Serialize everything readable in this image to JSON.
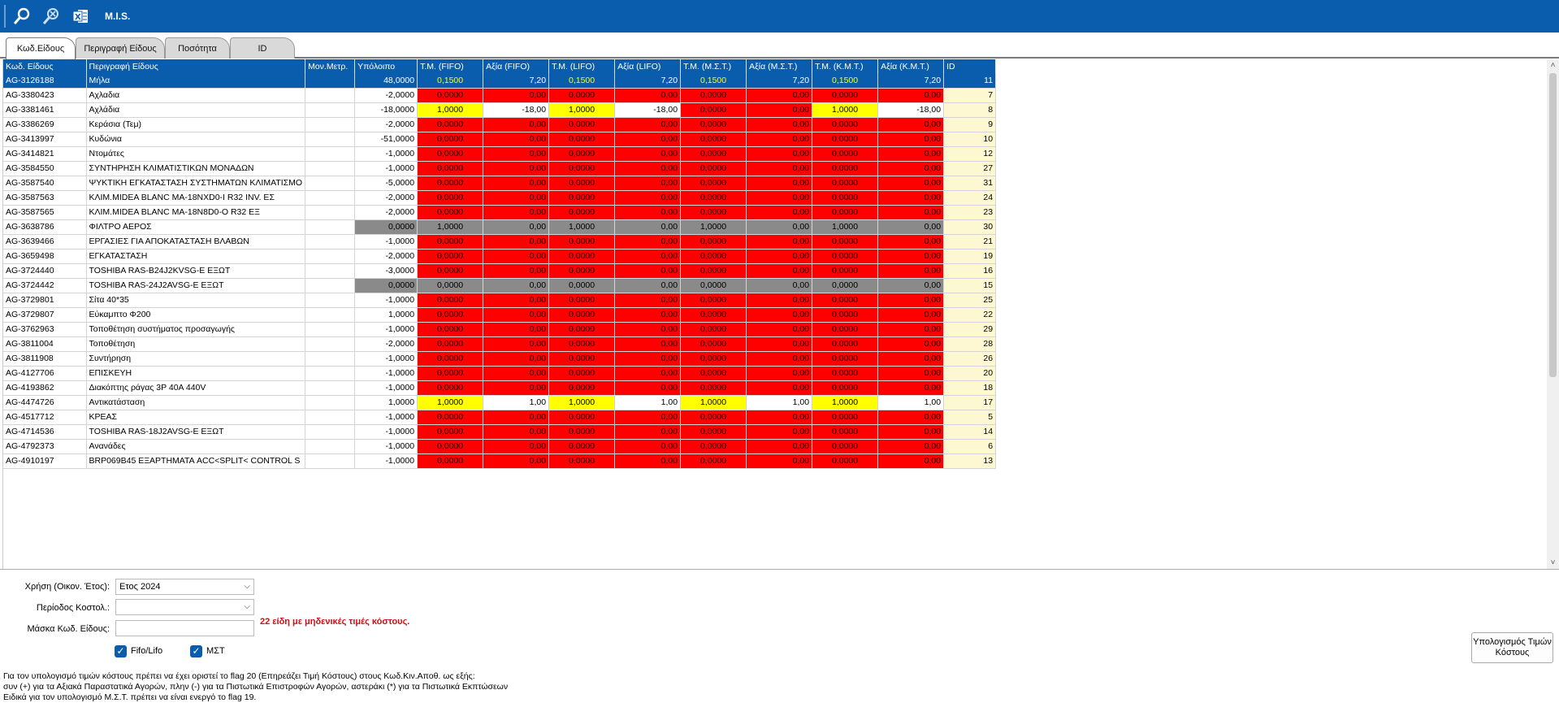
{
  "app": {
    "title": "M.I.S."
  },
  "toolbar": {
    "icons": [
      "search-icon",
      "zoom-config-icon",
      "excel-icon"
    ]
  },
  "tabs": [
    "Κωδ.Είδους",
    "Περιγραφή Είδους",
    "Ποσότητα",
    "ID"
  ],
  "grid": {
    "columns": [
      "Κωδ. Είδους",
      "Περιγραφή Είδους",
      "Μον.Μετρ.",
      "Υπόλοιπο",
      "Τ.Μ. (FIFO)",
      "Αξία (FIFO)",
      "Τ.Μ. (LIFO)",
      "Αξία (LIFO)",
      "Τ.Μ. (Μ.Σ.Τ.)",
      "Αξία (Μ.Σ.Τ.)",
      "Τ.Μ. (Κ.Μ.Τ.)",
      "Αξία (Κ.Μ.Τ.)",
      "ID"
    ],
    "rows": [
      {
        "code": "AG-3126188",
        "desc": "Μήλα",
        "unit": "",
        "bal": "48,0000",
        "v": [
          "0,1500",
          "7,20",
          "0,1500",
          "7,20",
          "0,1500",
          "7,20",
          "0,1500",
          "7,20"
        ],
        "id": "11",
        "style": "selected"
      },
      {
        "code": "AG-3380423",
        "desc": "Αχλαδια",
        "unit": "",
        "bal": "-2,0000",
        "v": [
          "0,0000",
          "0,00",
          "0,0000",
          "0,00",
          "0,0000",
          "0,00",
          "0,0000",
          "0,00"
        ],
        "id": "7",
        "style": "red"
      },
      {
        "code": "AG-3381461",
        "desc": "Αχλάδια",
        "unit": "",
        "bal": "-18,0000",
        "v": [
          "1,0000",
          "-18,00",
          "1,0000",
          "-18,00",
          "0,0000",
          "0,00",
          "1,0000",
          "-18,00"
        ],
        "id": "8",
        "style": "mix3"
      },
      {
        "code": "AG-3386269",
        "desc": "Κεράσια (Τεμ)",
        "unit": "",
        "bal": "-2,0000",
        "v": [
          "0,0000",
          "0,00",
          "0,0000",
          "0,00",
          "0,0000",
          "0,00",
          "0,0000",
          "0,00"
        ],
        "id": "9",
        "style": "red"
      },
      {
        "code": "AG-3413997",
        "desc": "Κυδώνια",
        "unit": "",
        "bal": "-51,0000",
        "v": [
          "0,0000",
          "0,00",
          "0,0000",
          "0,00",
          "0,0000",
          "0,00",
          "0,0000",
          "0,00"
        ],
        "id": "10",
        "style": "red"
      },
      {
        "code": "AG-3414821",
        "desc": "Ντομάτες",
        "unit": "",
        "bal": "-1,0000",
        "v": [
          "0,0000",
          "0,00",
          "0,0000",
          "0,00",
          "0,0000",
          "0,00",
          "0,0000",
          "0,00"
        ],
        "id": "12",
        "style": "red"
      },
      {
        "code": "AG-3584550",
        "desc": "ΣΥΝΤΗΡΗΣΗ ΚΛΙΜΑΤΙΣΤΙΚΩΝ ΜΟΝΑΔΩΝ",
        "unit": "",
        "bal": "-1,0000",
        "v": [
          "0,0000",
          "0,00",
          "0,0000",
          "0,00",
          "0,0000",
          "0,00",
          "0,0000",
          "0,00"
        ],
        "id": "27",
        "style": "red"
      },
      {
        "code": "AG-3587540",
        "desc": "ΨΥΚΤΙΚΗ ΕΓΚΑΤΑΣΤΑΣΗ ΣΥΣΤΗΜΑΤΩΝ ΚΛΙΜΑΤΙΣΜΟ",
        "unit": "",
        "bal": "-5,0000",
        "v": [
          "0,0000",
          "0,00",
          "0,0000",
          "0,00",
          "0,0000",
          "0,00",
          "0,0000",
          "0,00"
        ],
        "id": "31",
        "style": "red"
      },
      {
        "code": "AG-3587563",
        "desc": "ΚΛΙΜ.MIDEA BLANC MA-18NXD0-I R32 INV. ΕΣ",
        "unit": "",
        "bal": "-2,0000",
        "v": [
          "0,0000",
          "0,00",
          "0,0000",
          "0,00",
          "0,0000",
          "0,00",
          "0,0000",
          "0,00"
        ],
        "id": "24",
        "style": "red"
      },
      {
        "code": "AG-3587565",
        "desc": "ΚΛΙΜ.MIDEA BLANC MA-18N8D0-O R32 ΕΞ",
        "unit": "",
        "bal": "-2,0000",
        "v": [
          "0,0000",
          "0,00",
          "0,0000",
          "0,00",
          "0,0000",
          "0,00",
          "0,0000",
          "0,00"
        ],
        "id": "23",
        "style": "red"
      },
      {
        "code": "AG-3638786",
        "desc": "ΦΙΛΤΡΟ ΑΕΡΟΣ",
        "unit": "",
        "bal": "0,0000",
        "v": [
          "1,0000",
          "0,00",
          "1,0000",
          "0,00",
          "1,0000",
          "0,00",
          "1,0000",
          "0,00"
        ],
        "id": "30",
        "style": "gray"
      },
      {
        "code": "AG-3639466",
        "desc": "ΕΡΓΑΣΙΕΣ ΓΙΑ ΑΠΟΚΑΤΑΣΤΑΣΗ ΒΛΑΒΩΝ",
        "unit": "",
        "bal": "-1,0000",
        "v": [
          "0,0000",
          "0,00",
          "0,0000",
          "0,00",
          "0,0000",
          "0,00",
          "0,0000",
          "0,00"
        ],
        "id": "21",
        "style": "red"
      },
      {
        "code": "AG-3659498",
        "desc": "ΕΓΚΑΤΑΣΤΑΣΗ",
        "unit": "",
        "bal": "-2,0000",
        "v": [
          "0,0000",
          "0,00",
          "0,0000",
          "0,00",
          "0,0000",
          "0,00",
          "0,0000",
          "0,00"
        ],
        "id": "19",
        "style": "red"
      },
      {
        "code": "AG-3724440",
        "desc": "TOSHIBA RAS-B24J2KVSG-E ΕΞΩΤ",
        "unit": "",
        "bal": "-3,0000",
        "v": [
          "0,0000",
          "0,00",
          "0,0000",
          "0,00",
          "0,0000",
          "0,00",
          "0,0000",
          "0,00"
        ],
        "id": "16",
        "style": "red"
      },
      {
        "code": "AG-3724442",
        "desc": "TOSHIBA RAS-24J2AVSG-E ΕΞΩΤ",
        "unit": "",
        "bal": "0,0000",
        "v": [
          "0,0000",
          "0,00",
          "0,0000",
          "0,00",
          "0,0000",
          "0,00",
          "0,0000",
          "0,00"
        ],
        "id": "15",
        "style": "gray"
      },
      {
        "code": "AG-3729801",
        "desc": "Σίτα 40*35",
        "unit": "",
        "bal": "-1,0000",
        "v": [
          "0,0000",
          "0,00",
          "0,0000",
          "0,00",
          "0,0000",
          "0,00",
          "0,0000",
          "0,00"
        ],
        "id": "25",
        "style": "red"
      },
      {
        "code": "AG-3729807",
        "desc": "Εύκαμπτο Φ200",
        "unit": "",
        "bal": "1,0000",
        "v": [
          "0,0000",
          "0,00",
          "0,0000",
          "0,00",
          "0,0000",
          "0,00",
          "0,0000",
          "0,00"
        ],
        "id": "22",
        "style": "red"
      },
      {
        "code": "AG-3762963",
        "desc": "Τοποθέτηση συστήματος προσαγωγής",
        "unit": "",
        "bal": "-1,0000",
        "v": [
          "0,0000",
          "0,00",
          "0,0000",
          "0,00",
          "0,0000",
          "0,00",
          "0,0000",
          "0,00"
        ],
        "id": "29",
        "style": "red"
      },
      {
        "code": "AG-3811004",
        "desc": "Τοποθέτηση",
        "unit": "",
        "bal": "-2,0000",
        "v": [
          "0,0000",
          "0,00",
          "0,0000",
          "0,00",
          "0,0000",
          "0,00",
          "0,0000",
          "0,00"
        ],
        "id": "28",
        "style": "red"
      },
      {
        "code": "AG-3811908",
        "desc": "Συντήρηση",
        "unit": "",
        "bal": "-1,0000",
        "v": [
          "0,0000",
          "0,00",
          "0,0000",
          "0,00",
          "0,0000",
          "0,00",
          "0,0000",
          "0,00"
        ],
        "id": "26",
        "style": "red"
      },
      {
        "code": "AG-4127706",
        "desc": "ΕΠΙΣΚΕΥΗ",
        "unit": "",
        "bal": "-1,0000",
        "v": [
          "0,0000",
          "0,00",
          "0,0000",
          "0,00",
          "0,0000",
          "0,00",
          "0,0000",
          "0,00"
        ],
        "id": "20",
        "style": "red"
      },
      {
        "code": "AG-4193862",
        "desc": "Διακόπτης ράγας 3P 40A 440V",
        "unit": "",
        "bal": "-1,0000",
        "v": [
          "0,0000",
          "0,00",
          "0,0000",
          "0,00",
          "0,0000",
          "0,00",
          "0,0000",
          "0,00"
        ],
        "id": "18",
        "style": "red"
      },
      {
        "code": "AG-4474726",
        "desc": "Αντικατάσταση",
        "unit": "",
        "bal": "1,0000",
        "v": [
          "1,0000",
          "1,00",
          "1,0000",
          "1,00",
          "1,0000",
          "1,00",
          "1,0000",
          "1,00"
        ],
        "id": "17",
        "style": "yellow"
      },
      {
        "code": "AG-4517712",
        "desc": "ΚΡΕΑΣ",
        "unit": "",
        "bal": "-1,0000",
        "v": [
          "0,0000",
          "0,00",
          "0,0000",
          "0,00",
          "0,0000",
          "0,00",
          "0,0000",
          "0,00"
        ],
        "id": "5",
        "style": "red"
      },
      {
        "code": "AG-4714536",
        "desc": "TOSHIBA RAS-18J2AVSG-E ΕΞΩΤ",
        "unit": "",
        "bal": "-1,0000",
        "v": [
          "0,0000",
          "0,00",
          "0,0000",
          "0,00",
          "0,0000",
          "0,00",
          "0,0000",
          "0,00"
        ],
        "id": "14",
        "style": "red"
      },
      {
        "code": "AG-4792373",
        "desc": "Ανανάδες",
        "unit": "",
        "bal": "-1,0000",
        "v": [
          "0,0000",
          "0,00",
          "0,0000",
          "0,00",
          "0,0000",
          "0,00",
          "0,0000",
          "0,00"
        ],
        "id": "6",
        "style": "red"
      },
      {
        "code": "AG-4910197",
        "desc": "BRP069B45 ΕΞΑΡΤΗΜΑΤΑ ACC<SPLIT< CONTROL S",
        "unit": "",
        "bal": "-1,0000",
        "v": [
          "0,0000",
          "0,00",
          "0,0000",
          "0,00",
          "0,0000",
          "0,00",
          "0,0000",
          "0,00"
        ],
        "id": "13",
        "style": "red"
      }
    ]
  },
  "form": {
    "fiscal_label": "Χρήση (Οικον. Έτος):",
    "fiscal_value": "Ετος 2024",
    "period_label": "Περίοδος Κοστολ.:",
    "period_value": "",
    "mask_label": "Μάσκα Κωδ. Είδους:",
    "mask_value": "",
    "warning": "22 είδη με μηδενικές τιμές κόστους.",
    "fifo_label": "Fifo/Lifo",
    "fifo_checked": true,
    "mst_label": "ΜΣΤ",
    "mst_checked": true,
    "calc_button": "Υπολογισμός Τιμών Κόστους"
  },
  "notes": [
    "Για τον υπολογισμό τιμών κόστους πρέπει να έχει οριστεί το flag 20 (Επηρεάζει Τιμή Κόστους) στους Κωδ.Κιν.Αποθ. ως εξής:",
    "συν (+) για τα Αξιακά Παραστατικά Αγορών, πλην (-) για τα Πιστωτικά Επιστροφών Αγορών, αστεράκι (*) για τα Πιστωτικά Εκπτώσεων",
    "Ειδικά για τον υπολογισμό Μ.Σ.Τ. πρέπει να είναι ενεργό το flag 19."
  ],
  "colors": {
    "accent": "#0a5cad",
    "zero_cost": "#ff0000",
    "cost_value": "#ffff00",
    "zero_balance": "#8a8a8a",
    "id_bg": "#fdf8d2",
    "warning_text": "#d01010"
  }
}
